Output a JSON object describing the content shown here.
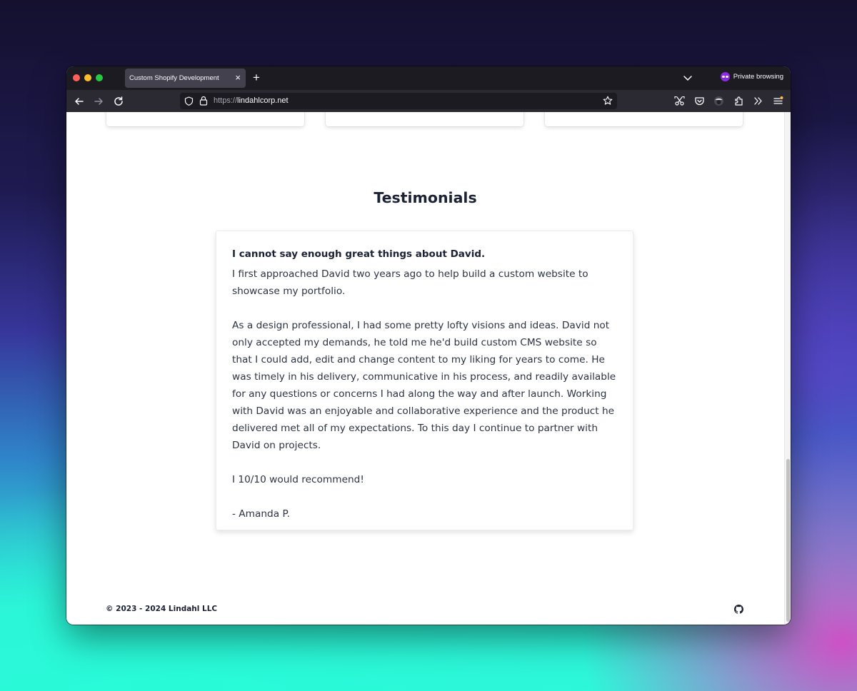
{
  "browser": {
    "tab": {
      "title": "Custom Shopify Development",
      "close_glyph": "×"
    },
    "new_tab_glyph": "+",
    "private_label": "Private browsing",
    "url": {
      "protocol": "https://",
      "host": "lindahlcorp.net"
    },
    "icons": {
      "tab_list": "chevron-down-icon",
      "private": "private-mask-icon",
      "back": "arrow-left-icon",
      "forward": "arrow-right-icon",
      "reload": "reload-icon",
      "tracking": "shield-icon",
      "security": "lock-icon",
      "bookmark": "star-icon",
      "screenshot": "screenshot-icon",
      "pocket": "pocket-icon",
      "profile": "profile-icon",
      "extensions": "puzzle-icon",
      "overflow": "chevrons-right-icon",
      "menu": "hamburger-menu-icon"
    }
  },
  "page": {
    "section_title": "Testimonials",
    "testimonial": {
      "heading": "I cannot say enough great things about David.",
      "paragraphs": [
        "I first approached David two years ago to help build a custom website to showcase my portfolio.",
        "As a design professional, I had some pretty lofty visions and ideas. David not only accepted my demands, he told me he'd build custom CMS website so that I could add, edit and change content to my liking for years to come. He was timely in his delivery, communicative in his process, and readily available for any questions or concerns I had along the way and after launch. Working with David was an enjoyable and collaborative experience and the product he delivered met all of my expectations. To this day I continue to partner with David on projects.",
        "I 10/10 would recommend!",
        "- Amanda P."
      ]
    },
    "footer": {
      "copyright": "© 2023 - 2024 Lindahl LLC",
      "github_icon": "github-icon"
    }
  },
  "colors": {
    "tabbar_bg": "#1c1b22",
    "navbar_bg": "#2b2a33",
    "heading_text": "#1b2235",
    "body_text": "#2c3345",
    "private_accent": "#8a2be2"
  }
}
